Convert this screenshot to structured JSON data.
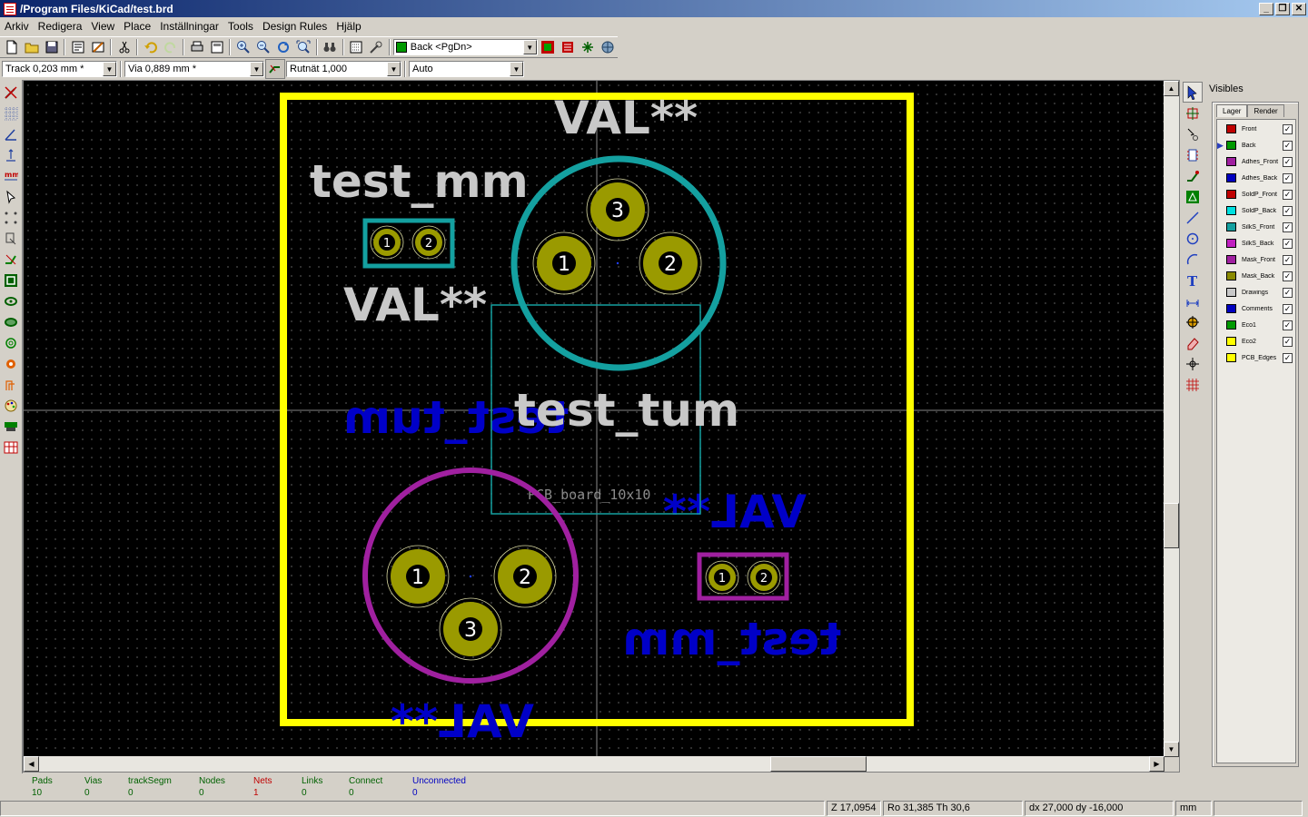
{
  "window": {
    "title": "/Program Files/KiCad/test.brd"
  },
  "menu": [
    "Arkiv",
    "Redigera",
    "View",
    "Place",
    "Inställningar",
    "Tools",
    "Design Rules",
    "Hjälp"
  ],
  "toolbar": {
    "layer_select": "Back <PgDn>",
    "layer_color": "#009900",
    "track_width": "Track 0,203 mm *",
    "via_size": "Via 0,889 mm *",
    "grid": "Rutnät 1,000",
    "zoom": "Auto"
  },
  "board": {
    "texts": {
      "val_top": "VAL**",
      "test_mm": "test_mm",
      "val_left": "VAL**",
      "test_tum": "test_tum",
      "test_tum_back": "test_tum",
      "pcb_board": "PCB_board_10x10",
      "val_right_back": "VAL**",
      "test_mm_back": "test_mm",
      "val_bottom_back": "VAL**"
    },
    "pads": {
      "tl_1": "1",
      "tl_2": "2",
      "top_1": "1",
      "top_2": "2",
      "top_3": "3",
      "bl_1": "1",
      "bl_2": "2",
      "bl_3": "3",
      "br_1": "1",
      "br_2": "2"
    },
    "colors": {
      "edge": "#ffff00",
      "silk_front": "#c8c8c8",
      "silk_front_outline": "#14a0a0",
      "silk_back": "#0000c8",
      "silk_back_outline": "#a020a0",
      "pad": "#9a9a00"
    }
  },
  "visibles": {
    "title": "Visibles",
    "tabs": [
      "Lager",
      "Render"
    ],
    "layers": [
      {
        "name": "Front",
        "color": "#c00000",
        "checked": "✓",
        "active": false
      },
      {
        "name": "Back",
        "color": "#009900",
        "checked": "✓",
        "active": true
      },
      {
        "name": "Adhes_Front",
        "color": "#a020a0",
        "checked": "✓",
        "active": false
      },
      {
        "name": "Adhes_Back",
        "color": "#0000c0",
        "checked": "✓",
        "active": false
      },
      {
        "name": "SoldP_Front",
        "color": "#c00000",
        "checked": "✓",
        "active": false
      },
      {
        "name": "SoldP_Back",
        "color": "#00e0e0",
        "checked": "✓",
        "active": false
      },
      {
        "name": "SilkS_Front",
        "color": "#14a0a0",
        "checked": "✓",
        "active": false
      },
      {
        "name": "SilkS_Back",
        "color": "#c020c0",
        "checked": "✓",
        "active": false
      },
      {
        "name": "Mask_Front",
        "color": "#a020a0",
        "checked": "✓",
        "active": false
      },
      {
        "name": "Mask_Back",
        "color": "#8a8a00",
        "checked": "✓",
        "active": false
      },
      {
        "name": "Drawings",
        "color": "#c8c8c8",
        "checked": "✓",
        "active": false
      },
      {
        "name": "Comments",
        "color": "#0000c0",
        "checked": "✓",
        "active": false
      },
      {
        "name": "Eco1",
        "color": "#009900",
        "checked": "✓",
        "active": false
      },
      {
        "name": "Eco2",
        "color": "#ffff00",
        "checked": "✓",
        "active": false
      },
      {
        "name": "PCB_Edges",
        "color": "#ffff00",
        "checked": "✓",
        "active": false
      }
    ]
  },
  "info": [
    {
      "label": "Pads",
      "value": "10",
      "style": "green"
    },
    {
      "label": "Vias",
      "value": "0",
      "style": "green"
    },
    {
      "label": "trackSegm",
      "value": "0",
      "style": "green"
    },
    {
      "label": "Nodes",
      "value": "0",
      "style": "green"
    },
    {
      "label": "Nets",
      "value": "1",
      "style": "red"
    },
    {
      "label": "Links",
      "value": "0",
      "style": "green"
    },
    {
      "label": "Connect",
      "value": "0",
      "style": "green"
    },
    {
      "label": "Unconnected",
      "value": "0",
      "style": "blue"
    }
  ],
  "status": {
    "zoom": "Z 17,0954",
    "polar": "Ro 31,385 Th 30,6",
    "delta": "dx 27,000  dy -16,000",
    "units": "mm"
  }
}
